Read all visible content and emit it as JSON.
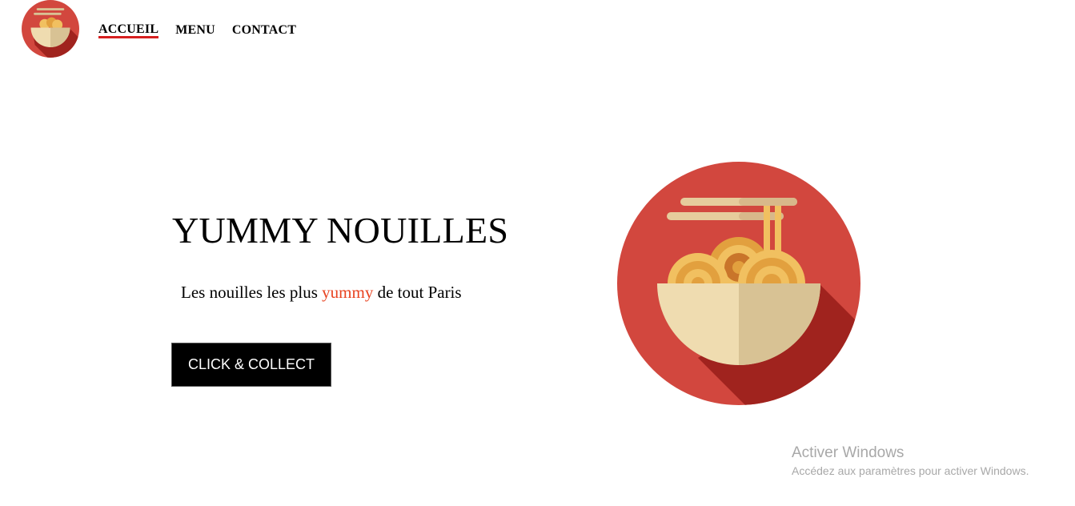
{
  "nav": {
    "items": [
      {
        "label": "ACCUEIL",
        "active": true
      },
      {
        "label": "MENU",
        "active": false
      },
      {
        "label": "CONTACT",
        "active": false
      }
    ]
  },
  "hero": {
    "title": "YUMMY NOUILLES",
    "subtitle_before": "Les nouilles les plus ",
    "subtitle_accent": "yummy",
    "subtitle_after": " de tout Paris",
    "cta_label": "CLICK & COLLECT"
  },
  "watermark": {
    "title": "Activer Windows",
    "subtitle": "Accédez aux paramètres pour activer Windows."
  },
  "icons": {
    "logo": "noodle-bowl-icon",
    "illustration": "noodle-bowl-icon"
  },
  "colors": {
    "circle_red": "#d2473e",
    "shadow_red": "#a0231e",
    "bowl_light": "#efdcb0",
    "bowl_dark": "#d8c294",
    "noodle": "#f1c060",
    "noodle_dark": "#e2a03e",
    "accent_text": "#e8421f",
    "active_underline": "#d61f1f",
    "button_bg": "#000000"
  }
}
